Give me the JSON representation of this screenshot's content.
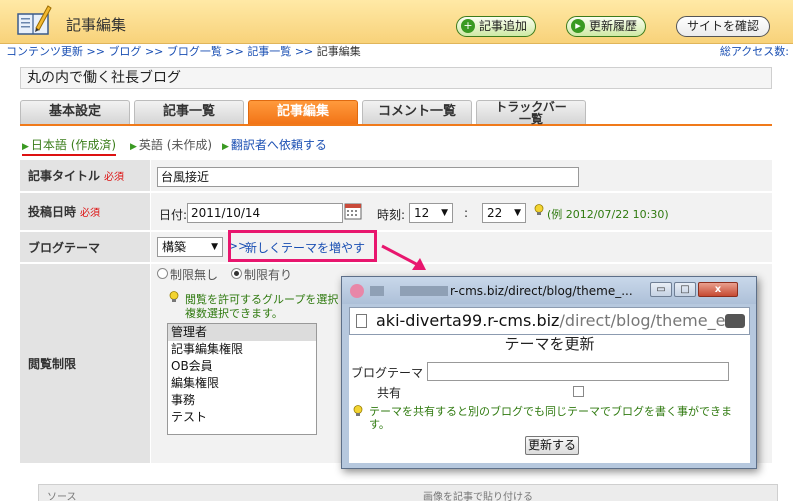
{
  "header": {
    "title": "記事編集",
    "buttons": {
      "add_article": "記事追加",
      "update_history": "更新履歴",
      "view_site": "サイトを確認"
    }
  },
  "breadcrumb": {
    "items": [
      "コンテンツ更新",
      "ブログ",
      "ブログ一覧",
      "記事一覧"
    ],
    "separator": ">>",
    "current": "記事編集"
  },
  "access_label": "総アクセス数:",
  "blog_name": "丸の内で働く社長ブログ",
  "tabs": [
    {
      "label": "基本設定"
    },
    {
      "label": "記事一覧"
    },
    {
      "label": "記事編集"
    },
    {
      "label": "コメント一覧"
    },
    {
      "label_line1": "トラックバー",
      "label_line2": "一覧"
    }
  ],
  "languages": {
    "japanese": "日本語 (作成済)",
    "english": "英語 (未作成)",
    "request": "翻訳者へ依頼する"
  },
  "form": {
    "title": {
      "label": "記事タイトル",
      "required": "必須",
      "value": "台風接近"
    },
    "posted": {
      "label": "投稿日時",
      "required": "必須",
      "date_label": "日付:",
      "date_value": "2011/10/14",
      "time_label": "時刻:",
      "hour": "12",
      "minute": "22",
      "example": "(例 2012/07/22 10:30)"
    },
    "theme": {
      "label": "ブログテーマ",
      "value": "構築",
      "prefix": ">>",
      "add_link": "新しくテーマを増やす"
    },
    "access": {
      "label": "閲覧制限",
      "radio_none": "制限無し",
      "radio_limited": "制限有り",
      "hint_line1": "閲覧を許可するグループを選択",
      "hint_line2": "複数選択できます。",
      "groups": [
        "管理者",
        "記事編集権限",
        "OB会員",
        "編集権限",
        "事務",
        "テスト"
      ]
    }
  },
  "toolbar": {
    "source": "ソース",
    "paste_image": "画像を記事で貼り付ける"
  },
  "popup": {
    "title": "r-cms.biz/direct/blog/theme_...",
    "url_main": "aki-diverta99.r-cms.biz",
    "url_path": "/direct/blog/theme_e",
    "heading": "テーマを更新",
    "theme_label": "ブログテーマ",
    "share_label": "共有",
    "hint": "テーマを共有すると別のブログでも同じテーマでブログを書く事ができます。",
    "submit": "更新する",
    "win_minimize": "▭",
    "win_maximize": "□",
    "win_close": "x"
  },
  "colors": {
    "header_bg": "#f8d27a",
    "tab_active": "#f27417",
    "link": "#1a4fb3",
    "required": "#d11111",
    "hint_green": "#2f7a0f",
    "highlight_box": "#e8166e"
  }
}
